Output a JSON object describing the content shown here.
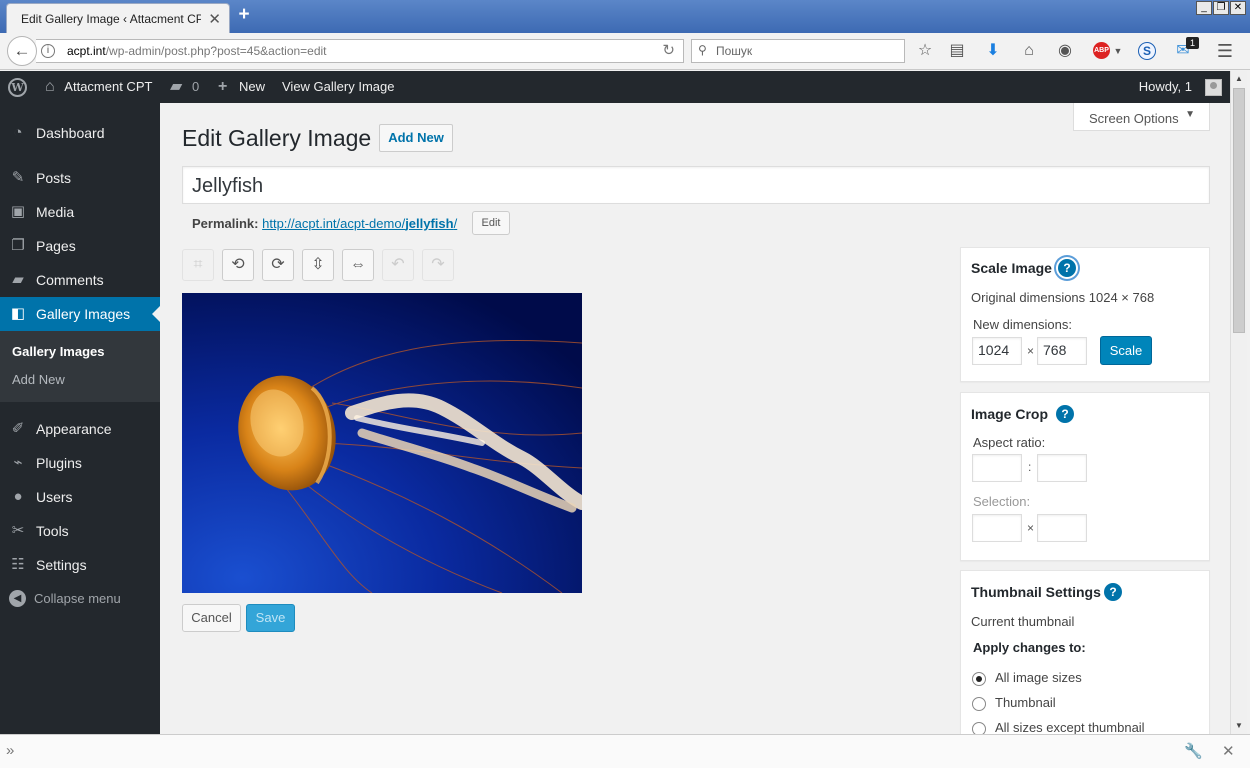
{
  "browser": {
    "tab_title": "Edit Gallery Image ‹ Attacment CP…",
    "tab_close": "✕",
    "new_tab": "+",
    "url_host": "acpt.int",
    "url_path": "/wp-admin/post.php?post=45&action=edit",
    "search_placeholder": "Пошук",
    "notification_badge": "1",
    "abp_label": "ABP",
    "s_label": "S"
  },
  "adminbar": {
    "site_name": "Attacment CPT",
    "comments_count": "0",
    "new_label": "New",
    "view_label": "View Gallery Image",
    "howdy": "Howdy, 1"
  },
  "sidebar": {
    "items": [
      {
        "label": "Dashboard",
        "icon": "dashboard-icon"
      },
      {
        "label": "Posts",
        "icon": "pin-icon"
      },
      {
        "label": "Media",
        "icon": "media-icon"
      },
      {
        "label": "Pages",
        "icon": "pages-icon"
      },
      {
        "label": "Comments",
        "icon": "comment-icon"
      },
      {
        "label": "Gallery Images",
        "icon": "gallery-icon"
      },
      {
        "label": "Appearance",
        "icon": "brush-icon"
      },
      {
        "label": "Plugins",
        "icon": "plugin-icon"
      },
      {
        "label": "Users",
        "icon": "user-icon"
      },
      {
        "label": "Tools",
        "icon": "wrench-icon"
      },
      {
        "label": "Settings",
        "icon": "sliders-icon"
      }
    ],
    "submenu": [
      "Gallery Images",
      "Add New"
    ],
    "collapse": "Collapse menu"
  },
  "main": {
    "screen_options": "Screen Options",
    "page_title": "Edit Gallery Image",
    "add_new": "Add New",
    "post_title": "Jellyfish",
    "permalink_label": "Permalink:",
    "permalink_base": "http://acpt.int/acpt-demo/",
    "permalink_slug": "jellyfish",
    "permalink_end": "/",
    "permalink_edit": "Edit",
    "cancel": "Cancel",
    "save": "Save"
  },
  "scale_image": {
    "title": "Scale Image",
    "original": "Original dimensions 1024 × 768",
    "new_dimensions": "New dimensions:",
    "width": "1024",
    "height": "768",
    "times": "×",
    "scale_button": "Scale"
  },
  "image_crop": {
    "title": "Image Crop",
    "aspect_ratio": "Aspect ratio:",
    "colon": ":",
    "selection": "Selection:",
    "times": "×"
  },
  "thumbnail": {
    "title": "Thumbnail Settings",
    "current": "Current thumbnail",
    "apply": "Apply changes to:",
    "options": [
      "All image sizes",
      "Thumbnail",
      "All sizes except thumbnail"
    ],
    "selected": 0
  },
  "colors": {
    "accent": "#0073aa",
    "admin_bg": "#23282d",
    "ocean_light": "#1a4fd0",
    "ocean_dark": "#000b4a"
  }
}
